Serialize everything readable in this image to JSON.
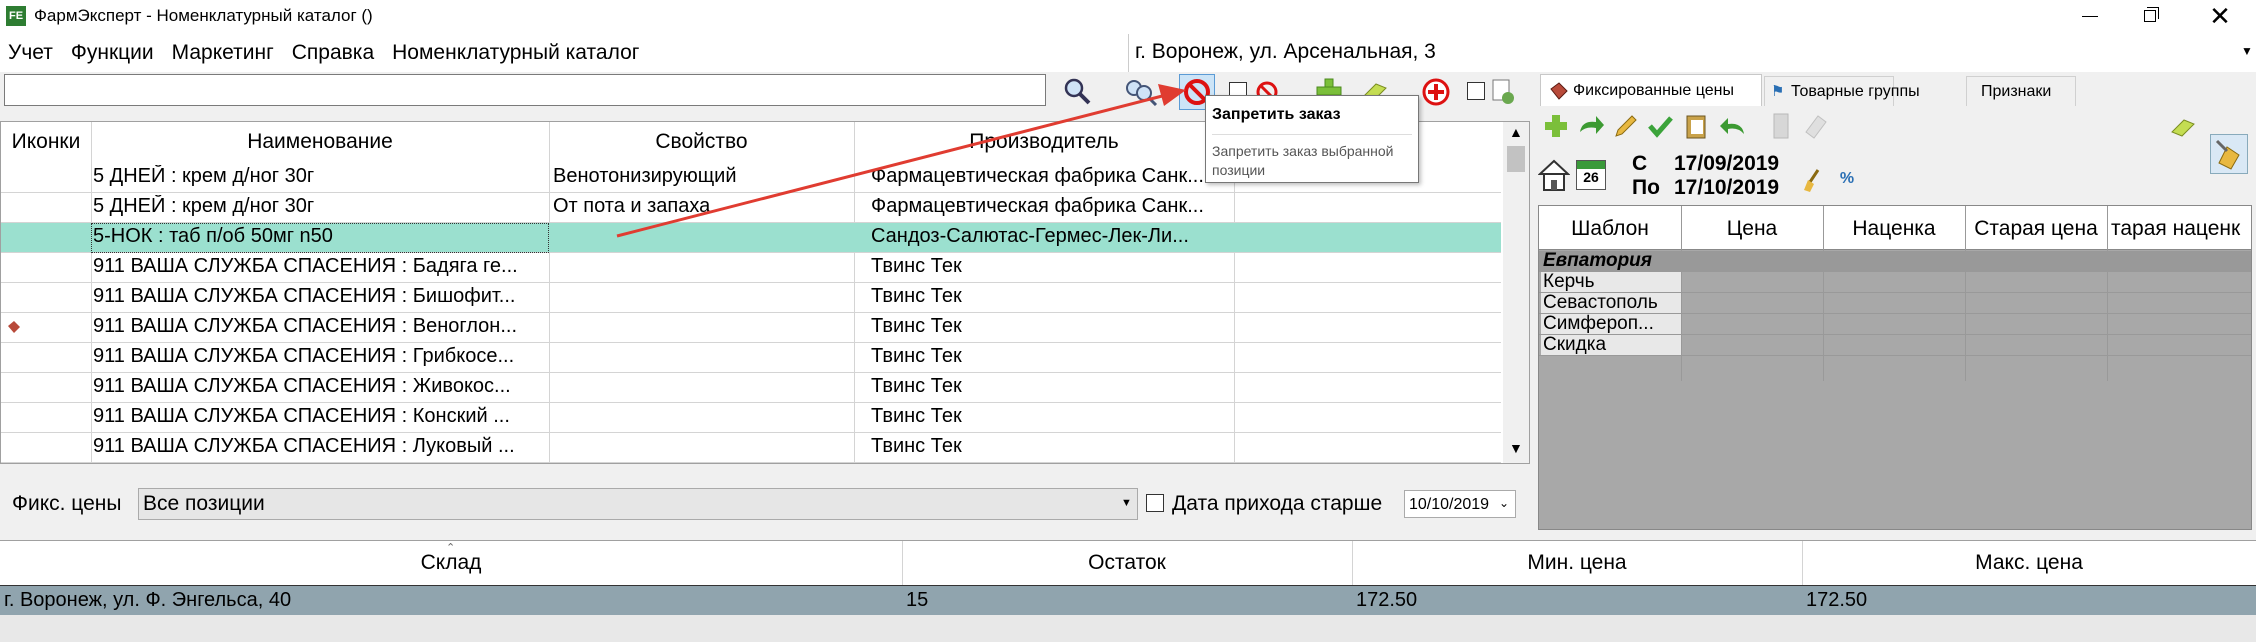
{
  "window": {
    "title": "ФармЭксперт - Номенклатурный каталог ()",
    "app_icon_text": "FE"
  },
  "menu": [
    "Учет",
    "Функции",
    "Маркетинг",
    "Справка",
    "Номенклатурный каталог"
  ],
  "store_select": {
    "value": "г. Воронеж, ул. Арсенальная, 3"
  },
  "search": {
    "value": "",
    "placeholder": ""
  },
  "tooltip": {
    "title": "Запретить заказ",
    "text": "Запретить заказ выбранной позиции"
  },
  "grid": {
    "headers": [
      "Иконки",
      "Наименование",
      "Свойство",
      "Производитель"
    ],
    "rows": [
      {
        "icon": "",
        "name": "5 ДНЕЙ : крем д/ног 30г",
        "prop": "Венотонизирующий",
        "maker": "Фармацевтическая фабрика Санк..."
      },
      {
        "icon": "",
        "name": "5 ДНЕЙ : крем д/ног 30г",
        "prop": "От пота и запаха",
        "maker": "Фармацевтическая фабрика Санк..."
      },
      {
        "icon": "",
        "name": "5-НОК : таб п/об 50мг n50",
        "prop": "",
        "maker": "Сандоз-Салютас-Гермес-Лек-Ли...",
        "selected": true
      },
      {
        "icon": "",
        "name": "911 ВАША СЛУЖБА СПАСЕНИЯ : Бадяга ге...",
        "prop": "",
        "maker": "Твинс Тек"
      },
      {
        "icon": "",
        "name": "911 ВАША СЛУЖБА СПАСЕНИЯ : Бишофит...",
        "prop": "",
        "maker": "Твинс Тек"
      },
      {
        "icon": "price-icon",
        "name": "911 ВАША СЛУЖБА СПАСЕНИЯ : Веноглон...",
        "prop": "",
        "maker": "Твинс Тек"
      },
      {
        "icon": "",
        "name": "911 ВАША СЛУЖБА СПАСЕНИЯ : Грибкосе...",
        "prop": "",
        "maker": "Твинс Тек"
      },
      {
        "icon": "",
        "name": "911 ВАША СЛУЖБА СПАСЕНИЯ : Живокос...",
        "prop": "",
        "maker": "Твинс Тек"
      },
      {
        "icon": "",
        "name": "911 ВАША СЛУЖБА СПАСЕНИЯ : Конский ...",
        "prop": "",
        "maker": "Твинс Тек"
      },
      {
        "icon": "",
        "name": "911 ВАША СЛУЖБА СПАСЕНИЯ : Луковый ...",
        "prop": "",
        "maker": "Твинс Тек"
      }
    ]
  },
  "filter": {
    "label": "Фикс. цены",
    "select_value": "Все позиции",
    "date_check_label": "Дата прихода старше",
    "date_value": "10/10/2019"
  },
  "right_panel": {
    "tabs": [
      "Фиксированные цены",
      "Товарные группы",
      "Признаки"
    ],
    "date_from_label": "С",
    "date_from": "17/09/2019",
    "date_to_label": "По",
    "date_to": "17/10/2019",
    "calendar_day": "26",
    "headers": [
      "Шаблон",
      "Цена",
      "Наценка",
      "Старая цена",
      "тарая наценк"
    ],
    "rows": [
      "Евпатория",
      "Керчь",
      "Севастополь",
      "Симфероп...",
      "Скидка"
    ]
  },
  "bottom": {
    "headers": [
      "Склад",
      "Остаток",
      "Мин. цена",
      "Макс. цена"
    ],
    "rows": [
      {
        "store": "г. Воронеж, ул. Ф. Энгельса, 40",
        "stock": "15",
        "min": "172.50",
        "max": "172.50"
      }
    ]
  },
  "colors": {
    "selected_row": "#9be0cf",
    "bottom_selected": "#90a4ae",
    "ban_red": "#d11",
    "arrow_red": "#e03c31"
  }
}
